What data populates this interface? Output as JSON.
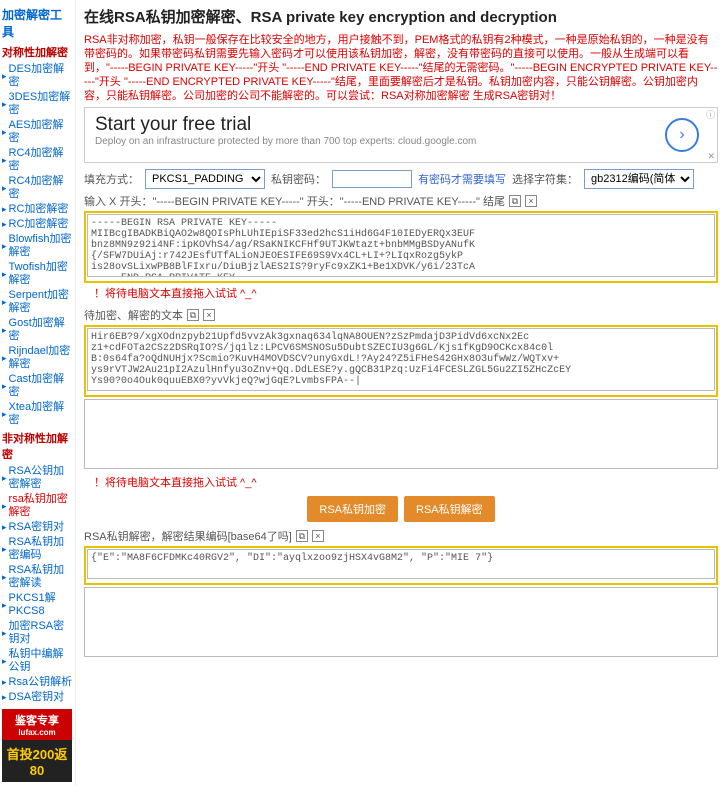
{
  "sidebar": {
    "title": "加密解密工具",
    "group1": {
      "label": "对称性加解密",
      "items": [
        "DES加密解密",
        "3DES加密解密",
        "AES加密解密",
        "RC4加密解密",
        "RC4加密解密",
        "RC加密解密",
        "RC加密解密",
        "Blowfish加密解密",
        "Twofish加密解密",
        "Serpent加密解密",
        "Gost加密解密",
        "Rijndael加密解密",
        "Cast加密解密",
        "Xtea加密解密"
      ]
    },
    "group2": {
      "label": "非对称性加解密",
      "items": [
        "RSA公钥加密解密",
        "rsa私钥加密解密",
        "RSA密钥对",
        "RSA私钥加密编码",
        "RSA私钥加密解读",
        "PKCS1解PKCS8",
        "加密RSA密钥对",
        "私钥中编解公钥",
        "Rsa公钥解析",
        "DSA密钥对"
      ]
    },
    "banner": {
      "top": "鉴客专享",
      "sub": "lufax.com",
      "bot": "首投200返80"
    }
  },
  "main": {
    "title": "在线RSA私钥加密解密、RSA private key encryption and decryption",
    "info": "RSA非对称加密，私钥一般保存在比较安全的地方，用户接触不到，PEM格式的私钥有2种模式，一种是原始私钥的，一种是没有带密码的。如果带密码私钥需要先输入密码才可以使用该私钥加密，解密，没有带密码的直接可以使用。一般从生成端可以看到，\"-----BEGIN PRIVATE KEY-----\"开头 \"-----END PRIVATE KEY-----\"结尾的无需密码。\"-----BEGIN ENCRYPTED PRIVATE KEY-----\"开头 \"-----END ENCRYPTED PRIVATE KEY-----\"结尾，里面要解密后才是私钥。私钥加密内容，只能公钥解密。公钥加密内容，只能私钥解密。公司加密的公司不能解密的。可以尝试：RSA对称加密解密 生成RSA密钥对！",
    "ad": {
      "h": "Start your free trial",
      "s": "Deploy on an infrastructure protected by more than 700 top experts: cloud.google.com"
    },
    "row1": {
      "l1": "填充方式：",
      "opt1": "PKCS1_PADDING",
      "l2": "私钥密码：",
      "hint": "有密码才需要填写",
      "l3": "选择字符集：",
      "opt2": "gb2312编码(简体)"
    },
    "sub1": {
      "text": "输入 X 开头：\"-----BEGIN PRIVATE KEY-----\" 开头：\"-----END PRIVATE KEY-----\" 结尾"
    },
    "ta1": "-----BEGIN RSA PRIVATE KEY-----\nMIIBcgIBADKBiQAO2w8QOIsPhLUhIEpiSF33ed2hcS1iHd6G4F10IEDyERQx3EUF\nbnz8MN9z92i4NF:ipKOVhS4/ag/RSaKNIKCFHf9UTJKWtazt+bnbMMgBSDyANufK\n{/SFW7DUiAj:r742JEsfUTfALioNJEOESIFE69S9Vx4CL+LI+?LIqxRozg5ykP\nis28ovSLixwPB8BlFIxru/DiuBjzlAES2IS?9ryFc9xZK1+Be1XDVK/y6i/23TcA\n-----END RSA PRIVATE KEY-----",
    "warn1": "！将待电脑文本直接拖入试试 ^_^",
    "sub2": {
      "text": "待加密、解密的文本"
    },
    "ta2": "Hir6EB?9/xgXOdnzpyb21Upfd5vvzAk3gxnaq634lqNA8OUEN?zSzPmdajD3PidVd6xcNx2Ec\nz1+cdFOTa2CSz2DSRqIO?S/jq1lz:LPCV6SMSNOSu5DubtSZECIU3g6GL/Kjs1fKgD9OCKcx84c0l\nB:0s64fa?oQdNUHjx?Scmio?KuvH4MOVDSCV?unyGxdL!?Ay24?Z5iFHeS42GHx8O3ufwWz/WQTxv+\nys9rVTJW2Au21pI2AzulHnfyu3oZnv+Qq.DdLESE?y.gQCB31Pzq:UzFi4FCESLZGL5Gu2ZI5ZHcZcEY\nYs90?0o4Ouk0quuEBX0?yvVkjeQ?wjGqE?LvmbsFPA--|",
    "warn2": "！将待电脑文本直接拖入试试 ^_^",
    "btn1": "RSA私钥加密",
    "btn2": "RSA私钥解密",
    "sub3": {
      "text": "RSA私钥解密，解密结果编码[base64了吗]"
    },
    "ta3": "{\"E\":\"MA8F6CFDMKc40RGV2\", \"DI\":\"ayqlxzoo9zjHSX4vG8M2\", \"P\":\"MIE 7\"}"
  }
}
